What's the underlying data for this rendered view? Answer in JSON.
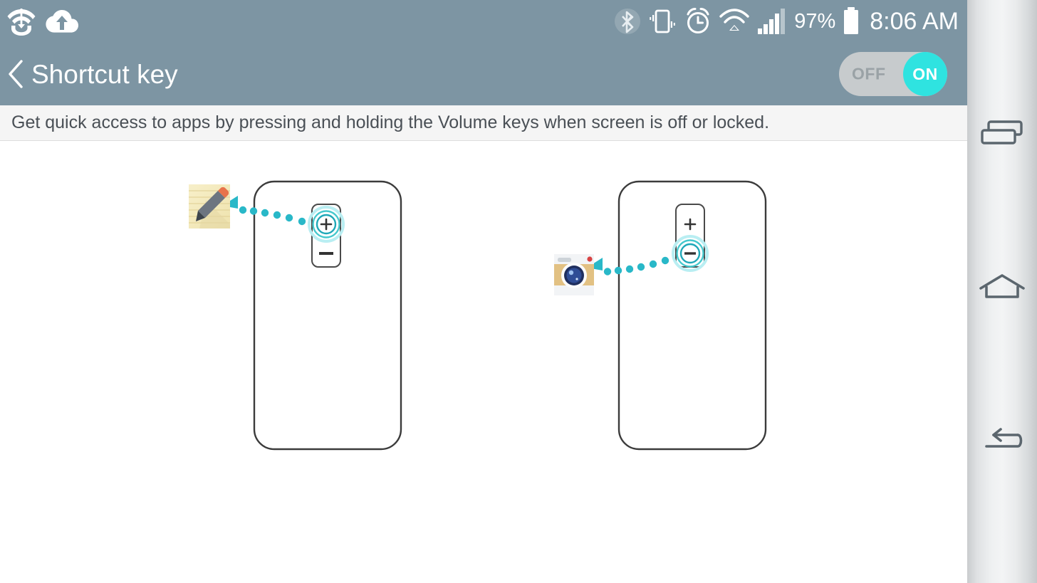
{
  "status_bar": {
    "left_icons": [
      {
        "name": "wifi-direct-icon",
        "label": "Wi-Fi Direct"
      },
      {
        "name": "cloud-upload-icon",
        "label": "Cloud upload"
      }
    ],
    "right_icons": [
      {
        "name": "bluetooth-icon",
        "label": "Bluetooth"
      },
      {
        "name": "vibrate-icon",
        "label": "Vibrate mode"
      },
      {
        "name": "alarm-icon",
        "label": "Alarm set"
      },
      {
        "name": "wifi-icon",
        "label": "Wi-Fi"
      },
      {
        "name": "signal-icon",
        "label": "Mobile signal"
      }
    ],
    "battery_percent": "97%",
    "battery_icon": "battery-full-icon",
    "clock": "8:06 AM",
    "background_color": "#7d95a3"
  },
  "title_bar": {
    "back_icon": "chevron-left-icon",
    "title": "Shortcut key",
    "toggle": {
      "off_label": "OFF",
      "on_label": "ON",
      "state": "ON",
      "track_color": "#c7cbcd",
      "knob_color": "#2fe3e0",
      "off_text_color": "#9aa2a6"
    }
  },
  "description": {
    "text": "Get quick access to apps by pressing and holding the Volume keys when screen is off or locked.",
    "background_color": "#f5f5f5",
    "text_color": "#4a5056"
  },
  "illustration": {
    "accent_color": "#29b8c8",
    "phone_outline_color": "#3b3b3b",
    "left": {
      "name": "volume-up-shortcut-diagram",
      "pressed_key": "+",
      "pressed_key_name": "volume-up-key",
      "other_key": "−",
      "other_key_name": "volume-down-key",
      "target_app": "Memo",
      "target_app_icon": "memo-icon"
    },
    "right": {
      "name": "volume-down-shortcut-diagram",
      "pressed_key": "−",
      "pressed_key_name": "volume-down-key",
      "other_key": "+",
      "other_key_name": "volume-up-key",
      "target_app": "Camera",
      "target_app_icon": "camera-icon"
    }
  },
  "nav_bar": {
    "buttons": [
      {
        "name": "nav-recents-button",
        "label": "Recent apps",
        "icon": "recents-icon"
      },
      {
        "name": "nav-home-button",
        "label": "Home",
        "icon": "home-icon"
      },
      {
        "name": "nav-back-button",
        "label": "Back",
        "icon": "back-icon"
      }
    ],
    "icon_color": "#5b666e"
  }
}
